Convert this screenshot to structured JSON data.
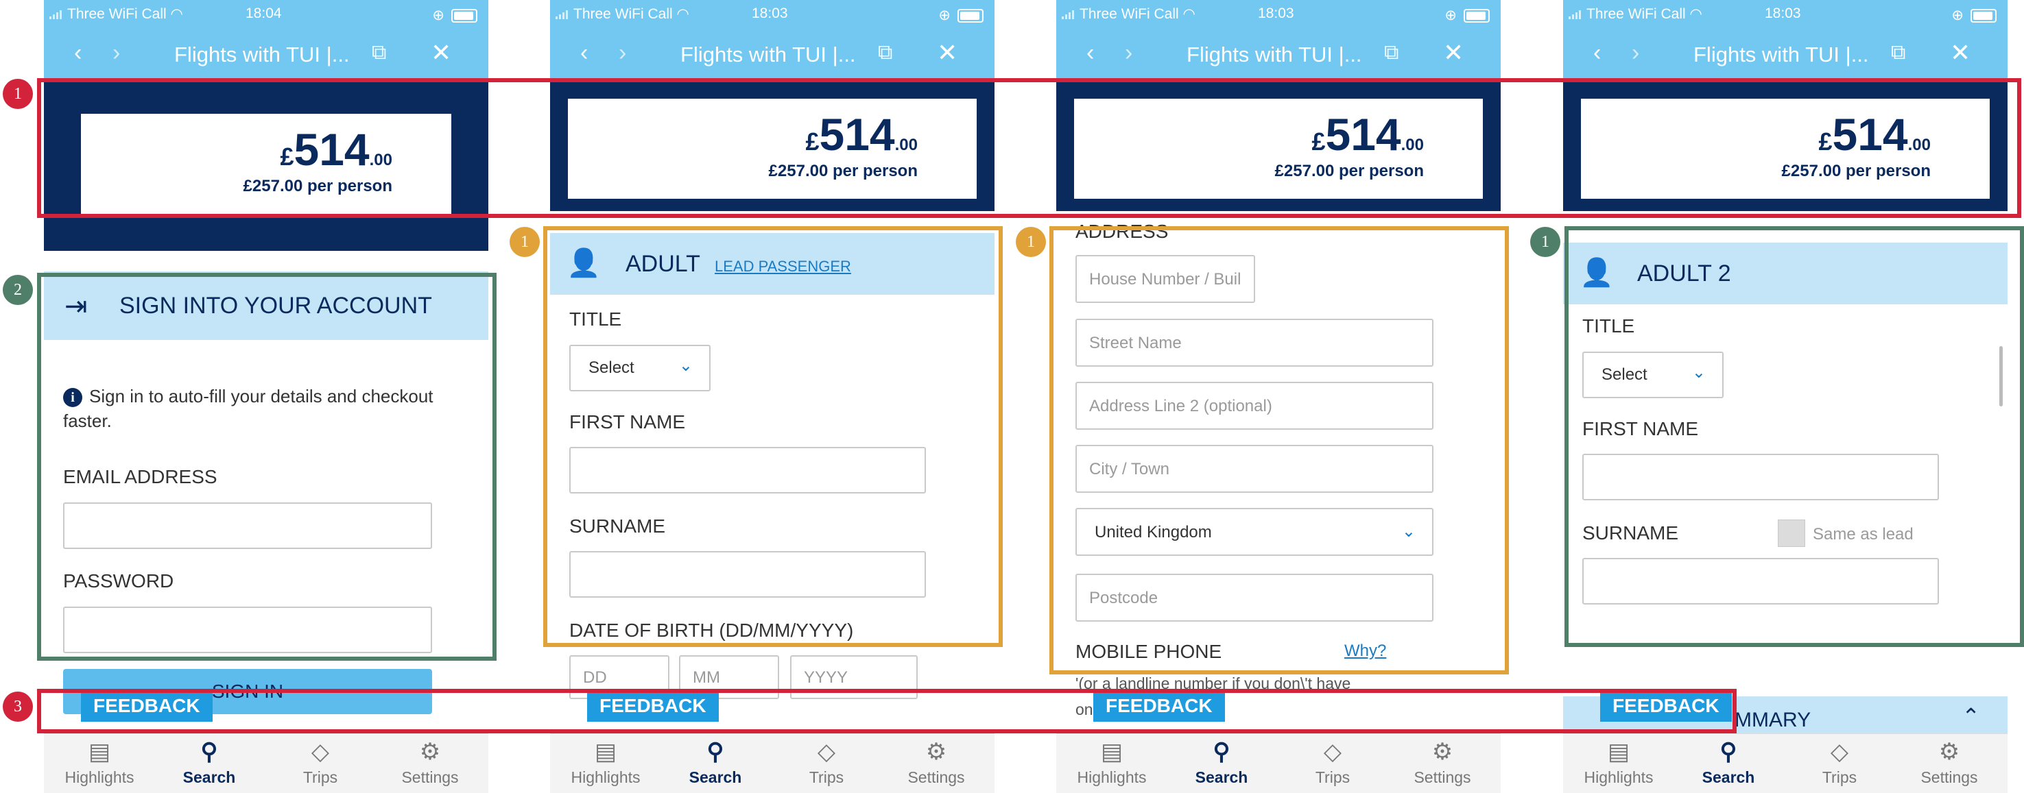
{
  "status": {
    "carrier": "Three WiFi Call",
    "time_1": "18:04",
    "time_other": "18:03"
  },
  "nav": {
    "title": "Flights with TUI |...",
    "back_icon": "chevron-left-icon",
    "forward_icon": "chevron-right-icon",
    "share_icon": "external-link-icon",
    "close_icon": "close-icon"
  },
  "price": {
    "currency": "£",
    "amount": "514",
    "decimals": ".00",
    "per_person": "£257.00 per person"
  },
  "signin": {
    "heading": "SIGN INTO YOUR ACCOUNT",
    "info": "Sign in to auto-fill your details and checkout faster.",
    "email_label": "EMAIL ADDRESS",
    "password_label": "PASSWORD",
    "button": "SIGN IN"
  },
  "adult": {
    "heading": "ADULT",
    "lead_link": "LEAD PASSENGER",
    "title_label": "TITLE",
    "select": "Select",
    "first_name": "FIRST NAME",
    "surname": "SURNAME",
    "dob": "DATE OF BIRTH (DD/MM/YYYY)",
    "dd": "DD",
    "mm": "MM",
    "yyyy": "YYYY"
  },
  "address": {
    "heading": "ADDRESS",
    "house": "House Number / Buil",
    "street": "Street Name",
    "line2": "Address Line 2 (optional)",
    "city": "City / Town",
    "country": "United Kingdom",
    "postcode": "Postcode",
    "mobile": "MOBILE PHONE",
    "why": "Why?",
    "note": "'(or a landline number if you don\\'t have",
    "note2": "on"
  },
  "adult2": {
    "heading": "ADULT 2",
    "title_label": "TITLE",
    "select": "Select",
    "first_name": "FIRST NAME",
    "surname": "SURNAME",
    "same_as_lead": "Same as lead",
    "summary_partial": "MMARY"
  },
  "feedback": "FEEDBACK",
  "tabs": [
    {
      "label": "Highlights",
      "icon": "newspaper-icon"
    },
    {
      "label": "Search",
      "icon": "search-icon"
    },
    {
      "label": "Trips",
      "icon": "tag-icon"
    },
    {
      "label": "Settings",
      "icon": "gear-icon"
    }
  ],
  "badges": {
    "one": "1",
    "two": "2",
    "three": "3"
  },
  "colors": {
    "sky": "#72c8f1",
    "navy": "#0a2a5e",
    "red": "#d2233b",
    "gold": "#e2a23a",
    "green": "#4f7f68",
    "feedback": "#1f9be0"
  }
}
